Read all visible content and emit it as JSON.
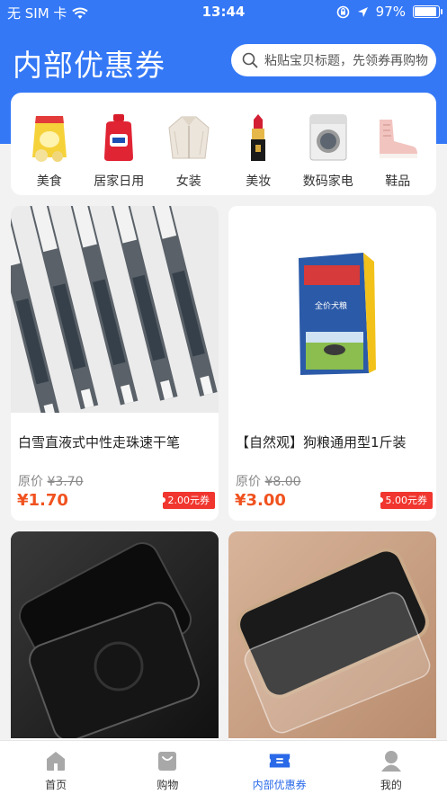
{
  "status_bar": {
    "carrier": "无 SIM 卡",
    "time": "13:44",
    "battery": "97%"
  },
  "header": {
    "title": "内部优惠券",
    "search_placeholder": "粘贴宝贝标题，先领券再购物"
  },
  "categories": [
    {
      "label": "美食",
      "icon": "snack-bag-icon"
    },
    {
      "label": "居家日用",
      "icon": "detergent-bottle-icon"
    },
    {
      "label": "女装",
      "icon": "jacket-icon"
    },
    {
      "label": "美妆",
      "icon": "lipstick-icon"
    },
    {
      "label": "数码家电",
      "icon": "washing-machine-icon"
    },
    {
      "label": "鞋品",
      "icon": "boot-icon"
    }
  ],
  "products": [
    {
      "name": "白雪直液式中性走珠速干笔",
      "orig_label": "原价",
      "orig_price": "¥3.70",
      "price": "¥1.70",
      "coupon": "2.00元券"
    },
    {
      "name": "【自然观】狗粮通用型1斤装",
      "orig_label": "原价",
      "orig_price": "¥8.00",
      "price": "¥3.00",
      "coupon": "5.00元券",
      "bag_text": "全价犬粮"
    },
    {
      "name": "",
      "image": "phone-screen-protector-dark"
    },
    {
      "name": "",
      "image": "phone-screen-protector-glass"
    }
  ],
  "tabbar": [
    {
      "label": "首页",
      "icon": "home-icon",
      "active": false
    },
    {
      "label": "购物",
      "icon": "shopping-bag-icon",
      "active": false
    },
    {
      "label": "内部优惠券",
      "icon": "coupon-icon",
      "active": true
    },
    {
      "label": "我的",
      "icon": "user-icon",
      "active": false
    }
  ],
  "colors": {
    "brand_blue": "#3478f6",
    "price_orange": "#f0521f",
    "coupon_red": "#f0362e",
    "active_tab": "#2a6ae8"
  }
}
